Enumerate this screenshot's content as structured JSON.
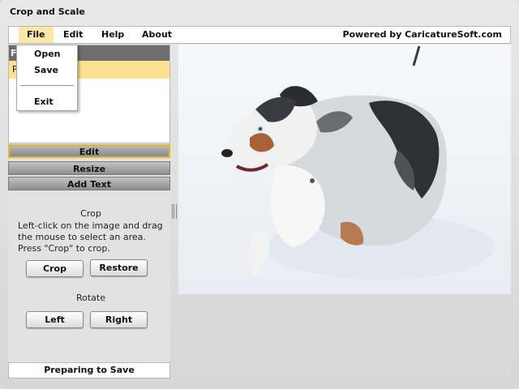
{
  "window": {
    "title": "Crop and Scale"
  },
  "menu": {
    "items": [
      "File",
      "Edit",
      "Help",
      "About"
    ],
    "active": "File",
    "powered_by": "Powered by CaricatureSoft.com",
    "file_dropdown": [
      "Open",
      "Save",
      "Exit"
    ]
  },
  "file_list": {
    "header": "Fi",
    "selected_row": "P"
  },
  "tabs": {
    "edit": "Edit",
    "resize": "Resize",
    "add_text": "Add Text",
    "selected": "Edit"
  },
  "crop": {
    "heading": "Crop",
    "instructions": "Left-click on the image and drag the mouse to select an area. Press \"Crop\" to crop.",
    "crop_button": "Crop",
    "restore_button": "Restore"
  },
  "rotate": {
    "heading": "Rotate",
    "left_button": "Left",
    "right_button": "Right"
  },
  "status": {
    "text": "Preparing to Save"
  },
  "colors": {
    "menu_active": "#fbe8a8",
    "selection_row": "#fde08e",
    "tab_selected_border": "#e3b830",
    "header_dark": "#6e6e6e"
  },
  "image": {
    "subject": "dog-in-snow-photo"
  }
}
